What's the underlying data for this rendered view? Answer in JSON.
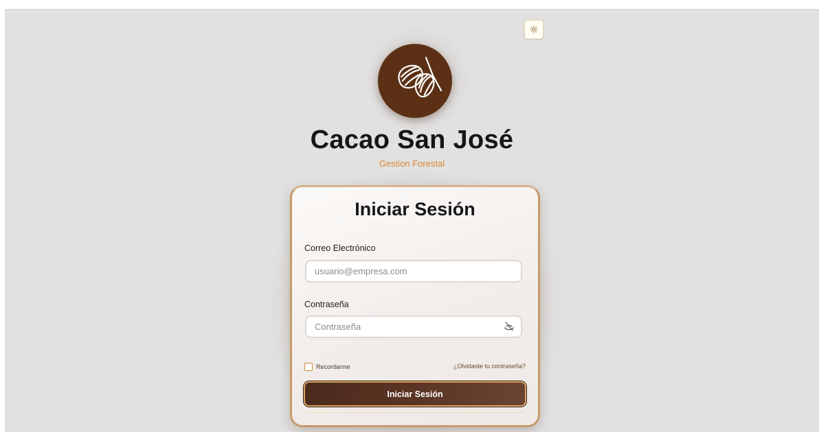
{
  "theme_toggle": {
    "icon": "sun-icon"
  },
  "brand": {
    "name": "Cacao San José",
    "subtitle": "Gestion Forestal",
    "logo_icon": "cacao-pod-icon"
  },
  "login": {
    "title": "Iniciar Sesión",
    "email": {
      "label": "Correo Electrónico",
      "placeholder": "usuario@empresa.com",
      "value": ""
    },
    "password": {
      "label": "Contraseña",
      "placeholder": "Contraseña",
      "value": "",
      "toggle_icon": "eye-off-icon"
    },
    "remember_label": "Recordarme",
    "remember_checked": false,
    "forgot_label": "¿Olvidaste tu contraseña?",
    "submit_label": "Iniciar Sesión"
  },
  "colors": {
    "background": "#e1e1e1",
    "logo_bg": "#5b3014",
    "accent_orange": "#d98a2e",
    "button_brown": "#5a3424",
    "button_border": "#d9a664"
  }
}
